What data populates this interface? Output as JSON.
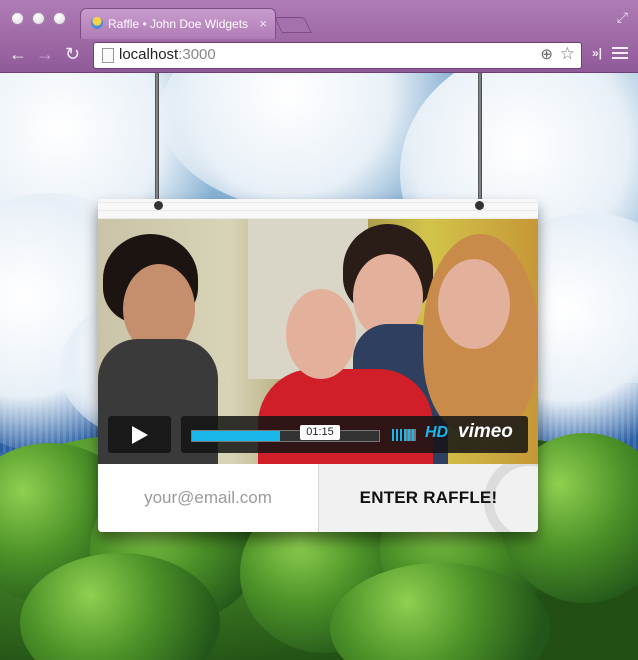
{
  "browser": {
    "tab_title": "Raffle • John Doe Widgets",
    "tab_close": "×",
    "url_host": "localhost",
    "url_port": ":3000",
    "nav": {
      "back": "←",
      "forward": "→",
      "reload": "↻"
    },
    "icons": {
      "zoom": "⊕",
      "star": "☆",
      "overflow": "»|",
      "fullscreen": "⤢"
    }
  },
  "video": {
    "time": "01:15",
    "progress_fraction": 0.47,
    "hd_label": "HD",
    "brand_label": "vimeo"
  },
  "form": {
    "email_placeholder": "your@email.com",
    "submit_label": "ENTER RAFFLE!"
  }
}
